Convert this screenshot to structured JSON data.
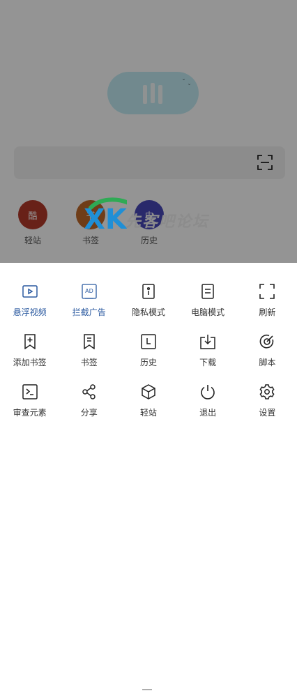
{
  "quick_links": [
    {
      "label": "轻站",
      "glyph": "酷",
      "color": "#7a1f1a"
    },
    {
      "label": "书签",
      "glyph": "书",
      "color": "#6b3a1a"
    },
    {
      "label": "历史",
      "glyph": "史",
      "color": "#2a2a6e"
    }
  ],
  "watermark": {
    "text": "先客吧论坛",
    "brand": "XK"
  },
  "menu": {
    "items": [
      {
        "label": "悬浮视频",
        "icon": "floating-video-icon",
        "active": true
      },
      {
        "label": "拦截广告",
        "icon": "ad-block-icon",
        "active": true
      },
      {
        "label": "隐私模式",
        "icon": "privacy-mode-icon"
      },
      {
        "label": "电脑模式",
        "icon": "desktop-mode-icon"
      },
      {
        "label": "刷新",
        "icon": "refresh-icon"
      },
      {
        "label": "添加书签",
        "icon": "add-bookmark-icon"
      },
      {
        "label": "书签",
        "icon": "bookmarks-icon"
      },
      {
        "label": "历史",
        "icon": "history-icon"
      },
      {
        "label": "下载",
        "icon": "download-icon"
      },
      {
        "label": "脚本",
        "icon": "script-icon"
      },
      {
        "label": "审查元素",
        "icon": "inspect-element-icon"
      },
      {
        "label": "分享",
        "icon": "share-icon"
      },
      {
        "label": "轻站",
        "icon": "light-site-icon"
      },
      {
        "label": "退出",
        "icon": "exit-icon"
      },
      {
        "label": "设置",
        "icon": "settings-icon"
      }
    ]
  },
  "colors": {
    "accent": "#2b5aa0",
    "text": "#333333"
  }
}
